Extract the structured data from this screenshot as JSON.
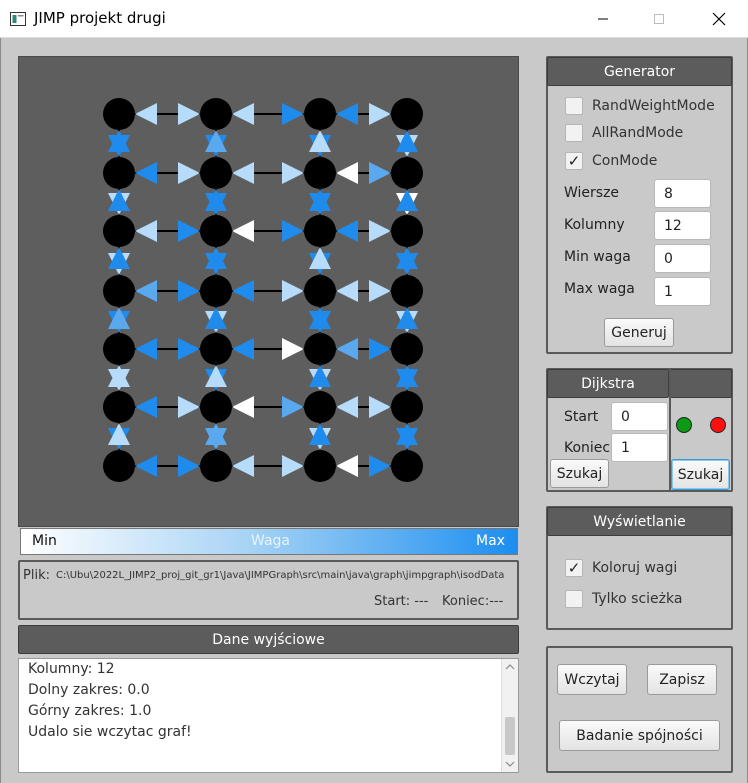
{
  "window": {
    "title": "JIMP projekt drugi"
  },
  "legend": {
    "min_label": "Min",
    "mid_label": "Waga",
    "max_label": "Max"
  },
  "file": {
    "label": "Plik:",
    "path": "C:\\Ubu\\2022L_JIMP2_proj_git_gr1\\Java\\JIMPGraph\\src\\main\\java\\graph\\jimpgraph\\isodData",
    "start_text": "Start: ---",
    "end_text": "Koniec:---"
  },
  "output": {
    "header": "Dane wyjściowe",
    "lines": [
      "Kolumny: 12",
      "Dolny zakres: 0.0",
      "Górny zakres: 1.0",
      "Udalo sie wczytac graf!"
    ]
  },
  "generator": {
    "header": "Generator",
    "checkboxes": [
      {
        "label": "RandWeightMode",
        "checked": false
      },
      {
        "label": "AllRandMode",
        "checked": false
      },
      {
        "label": "ConMode",
        "checked": true
      }
    ],
    "fields": [
      {
        "label": "Wiersze",
        "value": "8"
      },
      {
        "label": "Kolumny",
        "value": "12"
      },
      {
        "label": "Min waga",
        "value": "0"
      },
      {
        "label": "Max waga",
        "value": "1"
      }
    ],
    "button": "Generuj"
  },
  "dijkstra": {
    "header": "Dijkstra",
    "start_label": "Start",
    "start_value": "0",
    "end_label": "Koniec",
    "end_value": "1",
    "search_button": "Szukaj",
    "search_button_2": "Szukaj",
    "start_color": "#0a9a14",
    "end_color": "#ff1010"
  },
  "display": {
    "header": "Wyświetlanie",
    "checkboxes": [
      {
        "label": "Koloruj wagi",
        "checked": true
      },
      {
        "label": "Tylko scieżka",
        "checked": false
      }
    ]
  },
  "actions": {
    "load": "Wczytaj",
    "save": "Zapisz",
    "connectivity": "Badanie spójności"
  },
  "colors": {
    "arrow_dark": "#1f8bec",
    "arrow_mid": "#5aa9ef",
    "arrow_light": "#b7dbfb",
    "arrow_white": "#ffffff"
  }
}
